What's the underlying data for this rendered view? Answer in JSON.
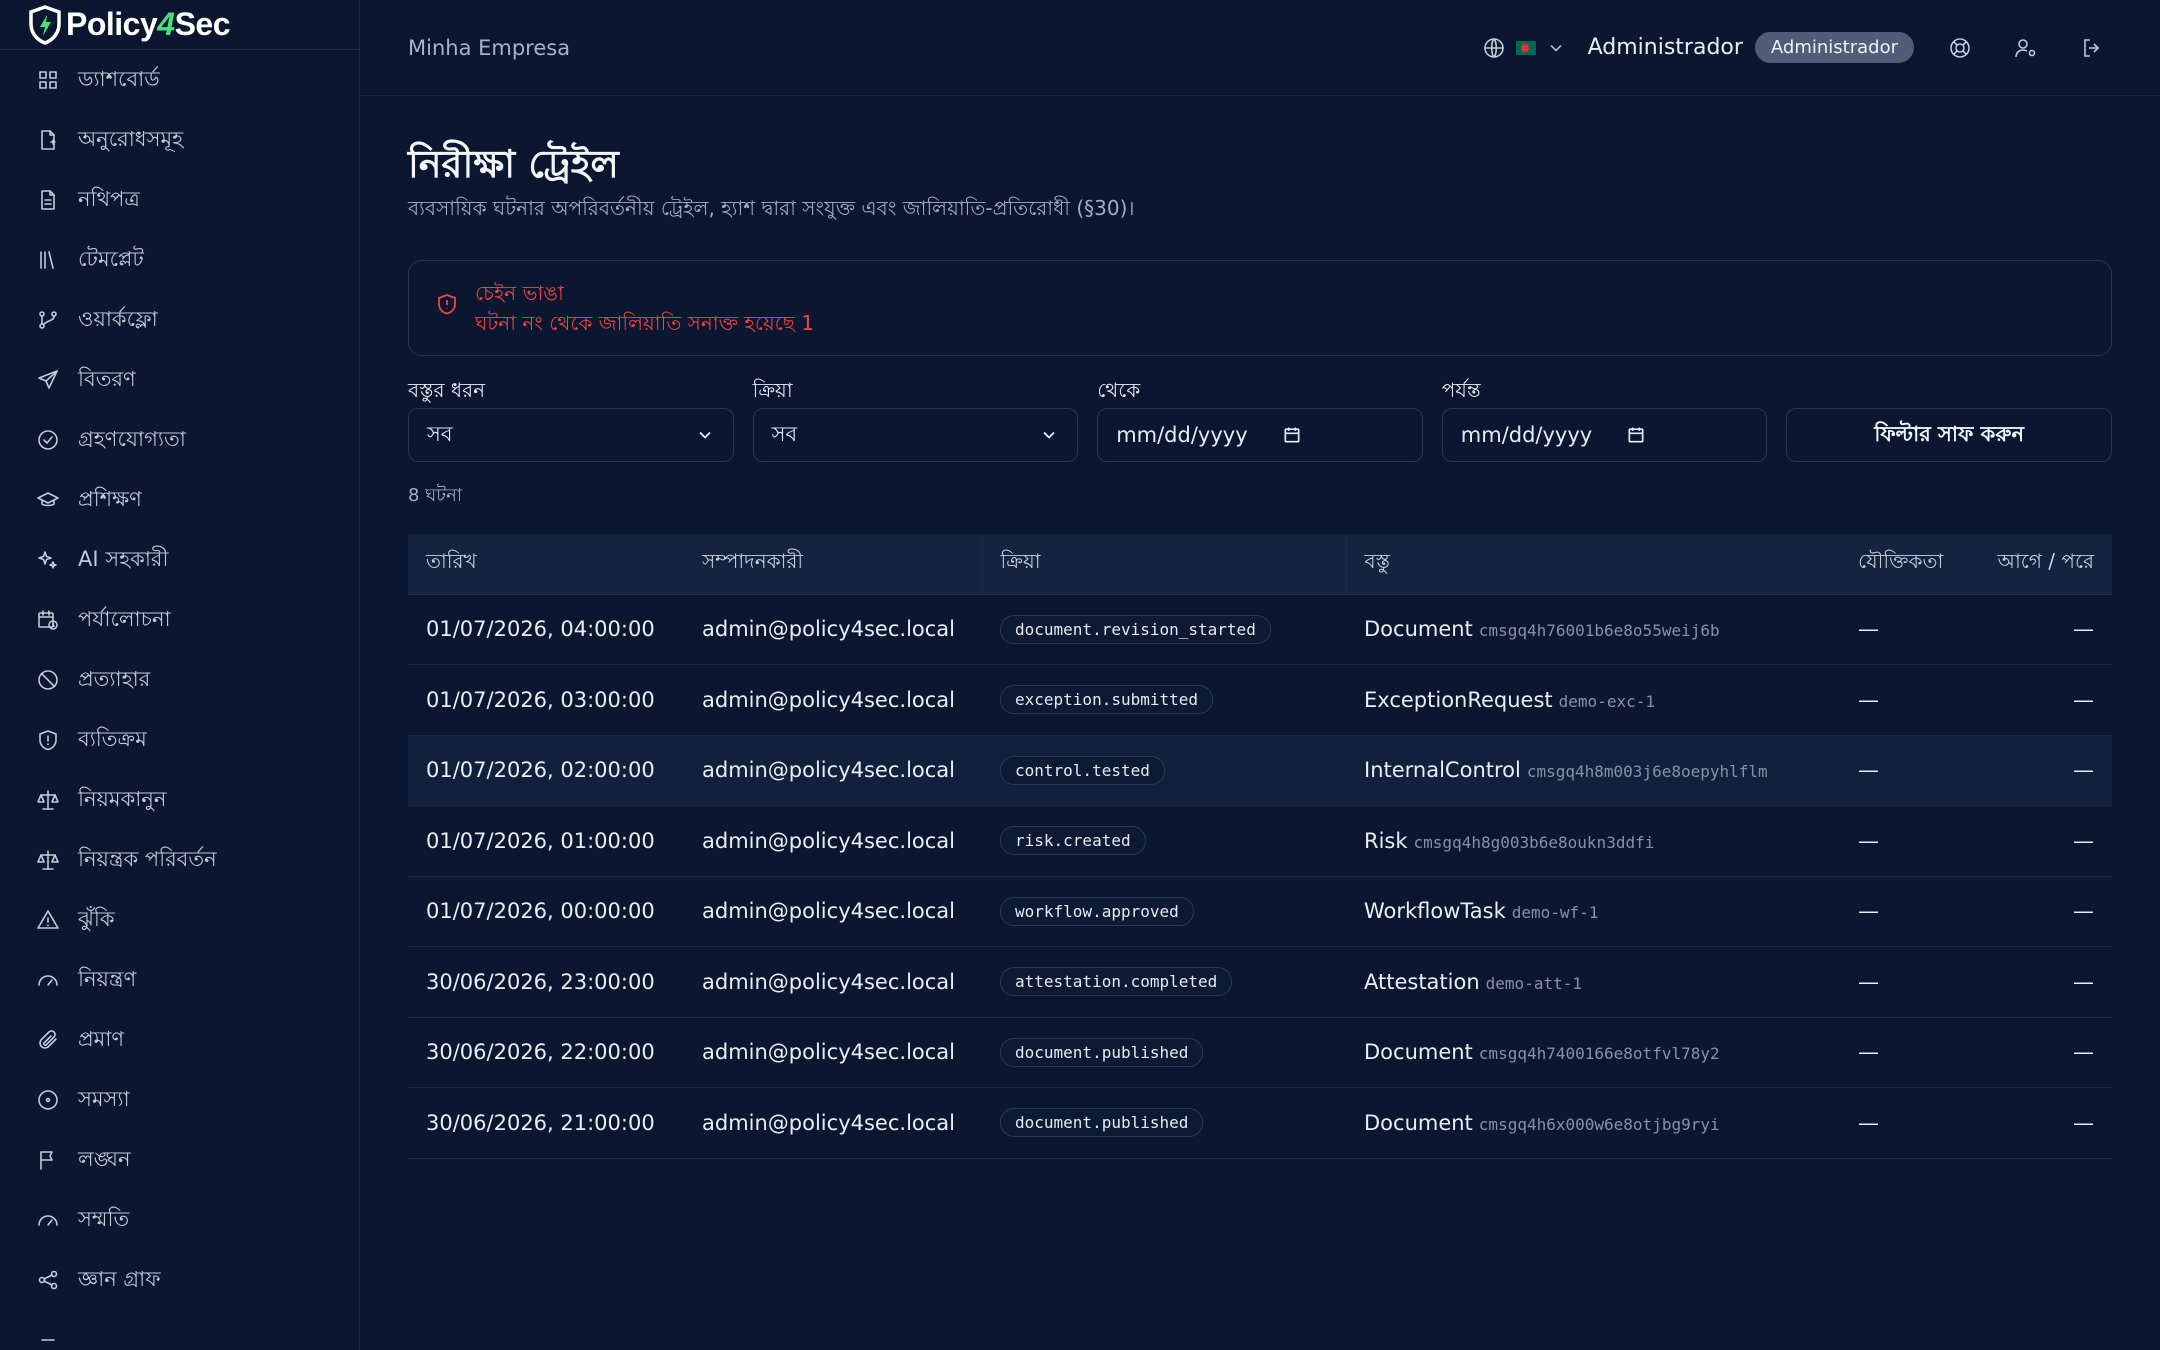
{
  "app": {
    "logo_prefix": "Policy",
    "logo_four": "4",
    "logo_suffix": "Sec"
  },
  "sidebar": {
    "items": [
      {
        "label": "ড্যাশবোর্ড",
        "icon": "dashboard-icon"
      },
      {
        "label": "অনুরোধসমূহ",
        "icon": "file-plus-icon"
      },
      {
        "label": "নথিপত্র",
        "icon": "document-icon"
      },
      {
        "label": "টেমপ্লেট",
        "icon": "library-icon"
      },
      {
        "label": "ওয়ার্কফ্লো",
        "icon": "git-branch-icon"
      },
      {
        "label": "বিতরণ",
        "icon": "send-icon"
      },
      {
        "label": "গ্রহণযোগ্যতা",
        "icon": "check-circle-icon"
      },
      {
        "label": "প্রশিক্ষণ",
        "icon": "graduation-cap-icon"
      },
      {
        "label": "AI সহকারী",
        "icon": "sparkles-icon"
      },
      {
        "label": "পর্যালোচনা",
        "icon": "calendar-clock-icon"
      },
      {
        "label": "প্রত্যাহার",
        "icon": "ban-icon"
      },
      {
        "label": "ব্যতিক্রম",
        "icon": "shield-alert-icon"
      },
      {
        "label": "নিয়মকানুন",
        "icon": "scale-icon"
      },
      {
        "label": "নিয়ন্ত্রক পরিবর্তন",
        "icon": "scale-icon"
      },
      {
        "label": "ঝুঁকি",
        "icon": "warning-triangle-icon"
      },
      {
        "label": "নিয়ন্ত্রণ",
        "icon": "gauge-icon"
      },
      {
        "label": "প্রমাণ",
        "icon": "paperclip-icon"
      },
      {
        "label": "সমস্যা",
        "icon": "circle-dot-icon"
      },
      {
        "label": "লঙ্ঘন",
        "icon": "flag-icon"
      },
      {
        "label": "সম্মতি",
        "icon": "gauge-icon"
      },
      {
        "label": "জ্ঞান গ্রাফ",
        "icon": "share-nodes-icon"
      },
      {
        "label": "",
        "icon": "more-icon"
      }
    ]
  },
  "header": {
    "org_name": "Minha Empresa",
    "user_name": "Administrador",
    "role_badge": "Administrador"
  },
  "page": {
    "title": "নিরীক্ষা ট্রেইল",
    "subtitle": "ব্যবসায়িক ঘটনার অপরিবর্তনীয় ট্রেইল, হ্যাশ দ্বারা সংযুক্ত এবং জালিয়াতি-প্রতিরোধী (§30)।"
  },
  "alert": {
    "title": "চেইন ভাঙা",
    "description": "ঘটনা নং থেকে জালিয়াতি সনাক্ত হয়েছে 1",
    "color": "#ef4444"
  },
  "filters": {
    "object_type": {
      "label": "বস্তুর ধরন",
      "value": "সব"
    },
    "action": {
      "label": "ক্রিয়া",
      "value": "সব"
    },
    "from": {
      "label": "থেকে",
      "placeholder": "mm/dd/yyyy"
    },
    "to": {
      "label": "পর্যন্ত",
      "placeholder": "mm/dd/yyyy"
    },
    "clear_label": "ফিল্টার সাফ করুন"
  },
  "count_label": "8 ঘটনা",
  "table": {
    "columns": {
      "date": "তারিখ",
      "actor": "সম্পাদনকারী",
      "action": "ক্রিয়া",
      "object": "বস্তু",
      "justification": "যৌক্তিকতা",
      "before_after": "আগে / পরে"
    },
    "rows": [
      {
        "date": "01/07/2026, 04:00:00",
        "actor": "admin@policy4sec.local",
        "action": "document.revision_started",
        "object_type": "Document",
        "object_id": "cmsgq4h76001b6e8o55weij6b",
        "justification": "—",
        "before_after": "—"
      },
      {
        "date": "01/07/2026, 03:00:00",
        "actor": "admin@policy4sec.local",
        "action": "exception.submitted",
        "object_type": "ExceptionRequest",
        "object_id": "demo-exc-1",
        "justification": "—",
        "before_after": "—"
      },
      {
        "date": "01/07/2026, 02:00:00",
        "actor": "admin@policy4sec.local",
        "action": "control.tested",
        "object_type": "InternalControl",
        "object_id": "cmsgq4h8m003j6e8oepyhlflm",
        "justification": "—",
        "before_after": "—"
      },
      {
        "date": "01/07/2026, 01:00:00",
        "actor": "admin@policy4sec.local",
        "action": "risk.created",
        "object_type": "Risk",
        "object_id": "cmsgq4h8g003b6e8oukn3ddfi",
        "justification": "—",
        "before_after": "—"
      },
      {
        "date": "01/07/2026, 00:00:00",
        "actor": "admin@policy4sec.local",
        "action": "workflow.approved",
        "object_type": "WorkflowTask",
        "object_id": "demo-wf-1",
        "justification": "—",
        "before_after": "—"
      },
      {
        "date": "30/06/2026, 23:00:00",
        "actor": "admin@policy4sec.local",
        "action": "attestation.completed",
        "object_type": "Attestation",
        "object_id": "demo-att-1",
        "justification": "—",
        "before_after": "—"
      },
      {
        "date": "30/06/2026, 22:00:00",
        "actor": "admin@policy4sec.local",
        "action": "document.published",
        "object_type": "Document",
        "object_id": "cmsgq4h7400166e8otfvl78y2",
        "justification": "—",
        "before_after": "—"
      },
      {
        "date": "30/06/2026, 21:00:00",
        "actor": "admin@policy4sec.local",
        "action": "document.published",
        "object_type": "Document",
        "object_id": "cmsgq4h6x000w6e8otjbg9ryi",
        "justification": "—",
        "before_after": "—"
      }
    ]
  },
  "colors": {
    "background": "#0b1730",
    "accent_green": "#4ade80",
    "danger": "#ef4444"
  }
}
